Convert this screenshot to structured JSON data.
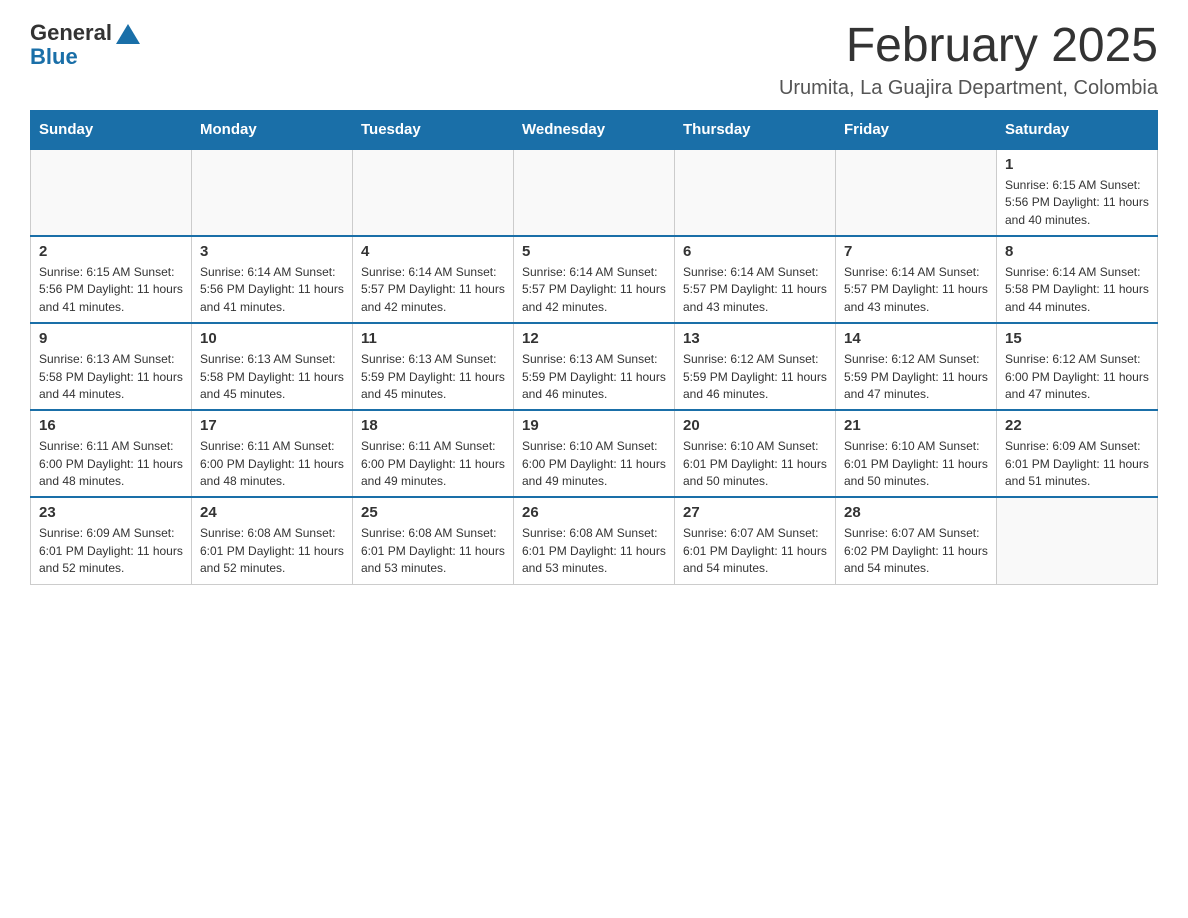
{
  "logo": {
    "general": "General",
    "blue": "Blue"
  },
  "header": {
    "title": "February 2025",
    "subtitle": "Urumita, La Guajira Department, Colombia"
  },
  "days_of_week": [
    "Sunday",
    "Monday",
    "Tuesday",
    "Wednesday",
    "Thursday",
    "Friday",
    "Saturday"
  ],
  "weeks": [
    [
      {
        "day": "",
        "info": ""
      },
      {
        "day": "",
        "info": ""
      },
      {
        "day": "",
        "info": ""
      },
      {
        "day": "",
        "info": ""
      },
      {
        "day": "",
        "info": ""
      },
      {
        "day": "",
        "info": ""
      },
      {
        "day": "1",
        "info": "Sunrise: 6:15 AM\nSunset: 5:56 PM\nDaylight: 11 hours and 40 minutes."
      }
    ],
    [
      {
        "day": "2",
        "info": "Sunrise: 6:15 AM\nSunset: 5:56 PM\nDaylight: 11 hours and 41 minutes."
      },
      {
        "day": "3",
        "info": "Sunrise: 6:14 AM\nSunset: 5:56 PM\nDaylight: 11 hours and 41 minutes."
      },
      {
        "day": "4",
        "info": "Sunrise: 6:14 AM\nSunset: 5:57 PM\nDaylight: 11 hours and 42 minutes."
      },
      {
        "day": "5",
        "info": "Sunrise: 6:14 AM\nSunset: 5:57 PM\nDaylight: 11 hours and 42 minutes."
      },
      {
        "day": "6",
        "info": "Sunrise: 6:14 AM\nSunset: 5:57 PM\nDaylight: 11 hours and 43 minutes."
      },
      {
        "day": "7",
        "info": "Sunrise: 6:14 AM\nSunset: 5:57 PM\nDaylight: 11 hours and 43 minutes."
      },
      {
        "day": "8",
        "info": "Sunrise: 6:14 AM\nSunset: 5:58 PM\nDaylight: 11 hours and 44 minutes."
      }
    ],
    [
      {
        "day": "9",
        "info": "Sunrise: 6:13 AM\nSunset: 5:58 PM\nDaylight: 11 hours and 44 minutes."
      },
      {
        "day": "10",
        "info": "Sunrise: 6:13 AM\nSunset: 5:58 PM\nDaylight: 11 hours and 45 minutes."
      },
      {
        "day": "11",
        "info": "Sunrise: 6:13 AM\nSunset: 5:59 PM\nDaylight: 11 hours and 45 minutes."
      },
      {
        "day": "12",
        "info": "Sunrise: 6:13 AM\nSunset: 5:59 PM\nDaylight: 11 hours and 46 minutes."
      },
      {
        "day": "13",
        "info": "Sunrise: 6:12 AM\nSunset: 5:59 PM\nDaylight: 11 hours and 46 minutes."
      },
      {
        "day": "14",
        "info": "Sunrise: 6:12 AM\nSunset: 5:59 PM\nDaylight: 11 hours and 47 minutes."
      },
      {
        "day": "15",
        "info": "Sunrise: 6:12 AM\nSunset: 6:00 PM\nDaylight: 11 hours and 47 minutes."
      }
    ],
    [
      {
        "day": "16",
        "info": "Sunrise: 6:11 AM\nSunset: 6:00 PM\nDaylight: 11 hours and 48 minutes."
      },
      {
        "day": "17",
        "info": "Sunrise: 6:11 AM\nSunset: 6:00 PM\nDaylight: 11 hours and 48 minutes."
      },
      {
        "day": "18",
        "info": "Sunrise: 6:11 AM\nSunset: 6:00 PM\nDaylight: 11 hours and 49 minutes."
      },
      {
        "day": "19",
        "info": "Sunrise: 6:10 AM\nSunset: 6:00 PM\nDaylight: 11 hours and 49 minutes."
      },
      {
        "day": "20",
        "info": "Sunrise: 6:10 AM\nSunset: 6:01 PM\nDaylight: 11 hours and 50 minutes."
      },
      {
        "day": "21",
        "info": "Sunrise: 6:10 AM\nSunset: 6:01 PM\nDaylight: 11 hours and 50 minutes."
      },
      {
        "day": "22",
        "info": "Sunrise: 6:09 AM\nSunset: 6:01 PM\nDaylight: 11 hours and 51 minutes."
      }
    ],
    [
      {
        "day": "23",
        "info": "Sunrise: 6:09 AM\nSunset: 6:01 PM\nDaylight: 11 hours and 52 minutes."
      },
      {
        "day": "24",
        "info": "Sunrise: 6:08 AM\nSunset: 6:01 PM\nDaylight: 11 hours and 52 minutes."
      },
      {
        "day": "25",
        "info": "Sunrise: 6:08 AM\nSunset: 6:01 PM\nDaylight: 11 hours and 53 minutes."
      },
      {
        "day": "26",
        "info": "Sunrise: 6:08 AM\nSunset: 6:01 PM\nDaylight: 11 hours and 53 minutes."
      },
      {
        "day": "27",
        "info": "Sunrise: 6:07 AM\nSunset: 6:01 PM\nDaylight: 11 hours and 54 minutes."
      },
      {
        "day": "28",
        "info": "Sunrise: 6:07 AM\nSunset: 6:02 PM\nDaylight: 11 hours and 54 minutes."
      },
      {
        "day": "",
        "info": ""
      }
    ]
  ]
}
